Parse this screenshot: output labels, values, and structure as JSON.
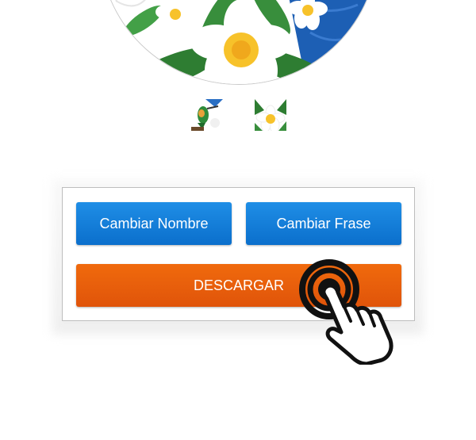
{
  "preview": {
    "image_name": "frangipani-flowers-artwork",
    "accent_blue": "#1d5fb4",
    "flower_yellow": "#f7c22a"
  },
  "thumbnails": [
    {
      "name": "hummingbird-thumbnail"
    },
    {
      "name": "frangipani-thumbnail"
    }
  ],
  "actions": {
    "change_name_label": "Cambiar Nombre",
    "change_phrase_label": "Cambiar Frase",
    "download_label": "DESCARGAR",
    "button_blue": "#1485de",
    "button_orange": "#ea5f0b"
  },
  "pointer": {
    "icon": "tap-hand-icon"
  }
}
